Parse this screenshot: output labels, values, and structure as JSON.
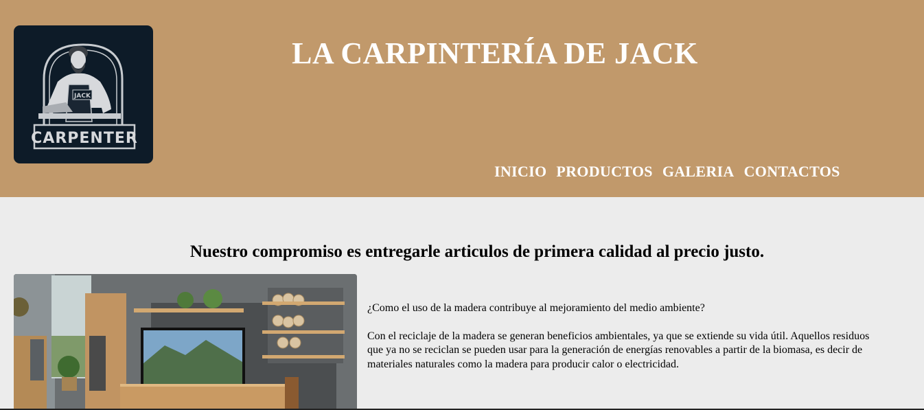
{
  "header": {
    "logo_text": "CARPENTER",
    "logo_apron_text": "JACK",
    "title": "LA CARPINTERÍA DE JACK",
    "nav": [
      "INICIO",
      "PRODUCTOS",
      "GALERIA",
      "CONTACTOS"
    ]
  },
  "main": {
    "headline": "Nuestro compromiso es entregarle articulos de primera calidad al precio justo.",
    "question": "¿Como el uso de la madera contribuye al mejoramiento del medio ambiente?",
    "answer_lines": [
      "Con el reciclaje de la madera se generan beneficios ambientales, ya que se extiende su vida útil. Aquellos residuos",
      "que ya no se reciclan se pueden usar para la generación de energías renovables a partir de la biomasa, es decir de",
      "materiales naturales como la madera para producir calor o electricidad."
    ]
  },
  "colors": {
    "header_bg": "#c1996b",
    "page_bg": "#ececec",
    "logo_bg": "#0d1b28"
  },
  "icons": {
    "logo": "carpenter-logo-icon",
    "photo": "furniture-photo-image"
  }
}
